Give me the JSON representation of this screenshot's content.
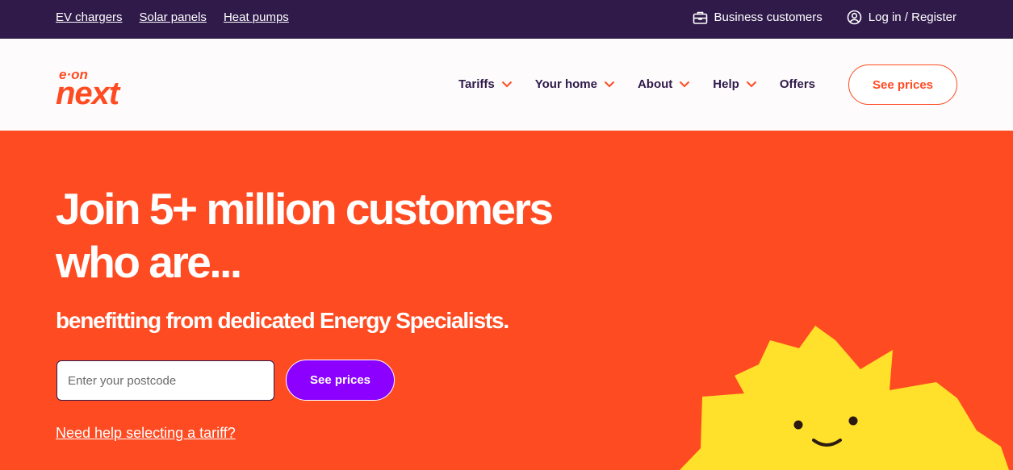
{
  "topbar": {
    "links": [
      "EV chargers",
      "Solar panels",
      "Heat pumps"
    ],
    "business_label": "Business customers",
    "login_label": "Log in / Register"
  },
  "header": {
    "logo_top": "e·on",
    "logo_main": "next",
    "nav": [
      "Tariffs",
      "Your home",
      "About",
      "Help",
      "Offers"
    ],
    "cta_label": "See prices"
  },
  "hero": {
    "headline": "Join 5+ million customers who are...",
    "subheadline": "benefitting from dedicated Energy Specialists.",
    "postcode_placeholder": "Enter your postcode",
    "cta_label": "See prices",
    "help_link": "Need help selecting a tariff?"
  },
  "colors": {
    "brand_orange": "#ff4b22",
    "top_bar_purple": "#2f1a4a",
    "cta_purple": "#8b00ff",
    "sun_yellow": "#ffe02a"
  }
}
